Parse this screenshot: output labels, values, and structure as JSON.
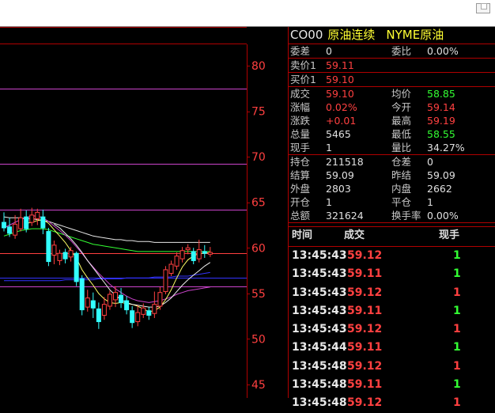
{
  "header": {
    "code": "CO00",
    "name": "原油连续",
    "category": "NYME原油"
  },
  "quote_groups": [
    [
      {
        "l1": "委差",
        "v1": "0",
        "c1": "white",
        "l2": "委比",
        "v2": "0.00%",
        "c2": "white"
      }
    ],
    [
      {
        "l1": "卖价1",
        "v1": "59.11",
        "c1": "red",
        "l2": "",
        "v2": "",
        "c2": "white"
      }
    ],
    [
      {
        "l1": "买价1",
        "v1": "59.10",
        "c1": "red",
        "l2": "",
        "v2": "",
        "c2": "white"
      }
    ],
    [
      {
        "l1": "成交",
        "v1": "59.10",
        "c1": "red",
        "l2": "均价",
        "v2": "58.85",
        "c2": "green"
      },
      {
        "l1": "涨幅",
        "v1": "0.02%",
        "c1": "red",
        "l2": "今开",
        "v2": "59.14",
        "c2": "red"
      },
      {
        "l1": "涨跌",
        "v1": "+0.01",
        "c1": "red",
        "l2": "最高",
        "v2": "59.19",
        "c2": "red"
      },
      {
        "l1": "总量",
        "v1": "5465",
        "c1": "white",
        "l2": "最低",
        "v2": "58.55",
        "c2": "green"
      },
      {
        "l1": "现手",
        "v1": "1",
        "c1": "white",
        "l2": "量比",
        "v2": "34.27%",
        "c2": "white"
      }
    ],
    [
      {
        "l1": "持仓",
        "v1": "211518",
        "c1": "white",
        "l2": "仓差",
        "v2": "0",
        "c2": "white"
      },
      {
        "l1": "结算",
        "v1": "59.09",
        "c1": "white",
        "l2": "昨结",
        "v2": "59.09",
        "c2": "white"
      },
      {
        "l1": "外盘",
        "v1": "2803",
        "c1": "white",
        "l2": "内盘",
        "v2": "2662",
        "c2": "white"
      },
      {
        "l1": "开仓",
        "v1": "1",
        "c1": "white",
        "l2": "平仓",
        "v2": "1",
        "c2": "white"
      },
      {
        "l1": "总额",
        "v1": "321624",
        "c1": "white",
        "l2": "换手率",
        "v2": "0.00%",
        "c2": "white"
      }
    ]
  ],
  "ticks": {
    "headers": {
      "time": "时间",
      "price": "成交",
      "volume": "现手"
    },
    "rows": [
      {
        "time": "13:45:43",
        "price": "59.12",
        "pc": "red",
        "vol": "1",
        "vc": "green"
      },
      {
        "time": "13:45:43",
        "price": "59.11",
        "pc": "red",
        "vol": "1",
        "vc": "green"
      },
      {
        "time": "13:45:43",
        "price": "59.12",
        "pc": "red",
        "vol": "1",
        "vc": "red"
      },
      {
        "time": "13:45:43",
        "price": "59.11",
        "pc": "red",
        "vol": "1",
        "vc": "green"
      },
      {
        "time": "13:45:43",
        "price": "59.12",
        "pc": "red",
        "vol": "1",
        "vc": "red"
      },
      {
        "time": "13:45:44",
        "price": "59.11",
        "pc": "red",
        "vol": "1",
        "vc": "green"
      },
      {
        "time": "13:45:48",
        "price": "59.12",
        "pc": "red",
        "vol": "1",
        "vc": "red"
      },
      {
        "time": "13:45:48",
        "price": "59.11",
        "pc": "red",
        "vol": "1",
        "vc": "green"
      },
      {
        "time": "13:45:48",
        "price": "59.12",
        "pc": "red",
        "vol": "1",
        "vc": "red"
      }
    ]
  },
  "chart_data": {
    "type": "candlestick",
    "y_ticks": [
      "80",
      "75",
      "70",
      "65",
      "60",
      "55",
      "50",
      "45"
    ],
    "ylim": [
      44,
      82
    ],
    "h_lines": [
      {
        "value": 77.5,
        "color": "#cc44cc"
      },
      {
        "value": 69.2,
        "color": "#cc44cc"
      },
      {
        "value": 64.2,
        "color": "#cc44cc"
      },
      {
        "value": 59.4,
        "color": "#ff4040"
      },
      {
        "value": 56.7,
        "color": "#3333ff"
      },
      {
        "value": 55.8,
        "color": "#cc44cc"
      }
    ],
    "candles": [
      {
        "o": 62.8,
        "c": 62.2,
        "h": 63.9,
        "l": 61.8
      },
      {
        "o": 62.3,
        "c": 61.6,
        "h": 63.3,
        "l": 61.2
      },
      {
        "o": 61.4,
        "c": 62.6,
        "h": 63.6,
        "l": 61.0
      },
      {
        "o": 62.1,
        "c": 63.3,
        "h": 64.3,
        "l": 61.8
      },
      {
        "o": 63.4,
        "c": 62.1,
        "h": 64.1,
        "l": 61.7
      },
      {
        "o": 62.8,
        "c": 63.6,
        "h": 64.4,
        "l": 62.4
      },
      {
        "o": 63.2,
        "c": 63.9,
        "h": 64.3,
        "l": 62.5
      },
      {
        "o": 63.4,
        "c": 62.2,
        "h": 64.2,
        "l": 61.5
      },
      {
        "o": 61.8,
        "c": 58.5,
        "h": 62.2,
        "l": 58.0
      },
      {
        "o": 59.2,
        "c": 60.3,
        "h": 60.8,
        "l": 58.2
      },
      {
        "o": 58.6,
        "c": 59.4,
        "h": 59.8,
        "l": 58.1
      },
      {
        "o": 59.5,
        "c": 58.8,
        "h": 59.9,
        "l": 58.3
      },
      {
        "o": 59.0,
        "c": 59.7,
        "h": 60.1,
        "l": 58.5
      },
      {
        "o": 59.4,
        "c": 56.3,
        "h": 59.6,
        "l": 55.8
      },
      {
        "o": 56.6,
        "c": 53.2,
        "h": 57.0,
        "l": 52.6
      },
      {
        "o": 53.5,
        "c": 54.5,
        "h": 55.4,
        "l": 53.0
      },
      {
        "o": 54.2,
        "c": 53.4,
        "h": 55.1,
        "l": 52.3
      },
      {
        "o": 53.3,
        "c": 51.9,
        "h": 54.0,
        "l": 51.1
      },
      {
        "o": 52.6,
        "c": 53.8,
        "h": 54.6,
        "l": 52.1
      },
      {
        "o": 53.6,
        "c": 54.9,
        "h": 55.3,
        "l": 53.2
      },
      {
        "o": 54.3,
        "c": 55.1,
        "h": 55.8,
        "l": 53.5
      },
      {
        "o": 54.8,
        "c": 54.0,
        "h": 55.6,
        "l": 53.4
      },
      {
        "o": 54.2,
        "c": 53.2,
        "h": 54.7,
        "l": 52.7
      },
      {
        "o": 53.1,
        "c": 51.8,
        "h": 53.6,
        "l": 51.2
      },
      {
        "o": 51.9,
        "c": 52.9,
        "h": 53.7,
        "l": 51.4
      },
      {
        "o": 52.7,
        "c": 53.4,
        "h": 53.9,
        "l": 52.3
      },
      {
        "o": 53.1,
        "c": 52.6,
        "h": 53.5,
        "l": 52.1
      },
      {
        "o": 52.8,
        "c": 53.8,
        "h": 55.2,
        "l": 52.3
      },
      {
        "o": 53.6,
        "c": 55.1,
        "h": 55.7,
        "l": 53.2
      },
      {
        "o": 55.2,
        "c": 57.6,
        "h": 58.0,
        "l": 54.9
      },
      {
        "o": 57.2,
        "c": 58.2,
        "h": 58.6,
        "l": 56.9
      },
      {
        "o": 58.0,
        "c": 59.1,
        "h": 59.5,
        "l": 57.6
      },
      {
        "o": 58.8,
        "c": 59.7,
        "h": 60.1,
        "l": 58.4
      },
      {
        "o": 59.8,
        "c": 60.0,
        "h": 60.4,
        "l": 59.3
      },
      {
        "o": 59.6,
        "c": 58.6,
        "h": 60.0,
        "l": 58.2
      },
      {
        "o": 58.8,
        "c": 59.8,
        "h": 60.9,
        "l": 58.4
      },
      {
        "o": 59.6,
        "c": 59.4,
        "h": 60.3,
        "l": 58.9
      },
      {
        "o": 59.3,
        "c": 59.5,
        "h": 60.1,
        "l": 59.0
      }
    ],
    "ma_lines": [
      {
        "color": "#e8e8e8",
        "values": [
          63.4,
          63.3,
          63.3,
          63.3,
          63.2,
          63.2,
          63.1,
          63.0,
          62.9,
          62.7,
          62.5,
          62.3,
          62.1,
          61.9,
          61.7,
          61.5,
          61.3,
          61.2,
          61.1,
          61.0,
          60.9,
          60.9,
          60.8,
          60.8,
          60.7,
          60.7,
          60.7,
          60.6,
          60.6,
          60.6,
          60.6,
          60.6,
          60.6,
          60.6,
          60.6,
          60.6,
          60.6,
          60.6
        ]
      },
      {
        "color": "#33ff33",
        "values": [
          61.3,
          61.5,
          61.7,
          61.9,
          62.0,
          62.1,
          62.1,
          62.1,
          62.0,
          61.8,
          61.6,
          61.4,
          61.2,
          61.0,
          60.8,
          60.6,
          60.4,
          60.3,
          60.2,
          60.1,
          60.0,
          59.9,
          59.8,
          59.7,
          59.6,
          59.6,
          59.6,
          59.6,
          59.6,
          59.6,
          59.6,
          59.6,
          59.6,
          59.6,
          59.6,
          59.6,
          59.6,
          59.6
        ]
      },
      {
        "color": "#cc44cc",
        "values": [
          62.2,
          62.5,
          62.8,
          63.1,
          63.3,
          63.5,
          63.5,
          63.3,
          62.9,
          62.4,
          61.9,
          61.4,
          60.8,
          60.1,
          59.4,
          58.6,
          57.9,
          57.2,
          56.6,
          56.0,
          55.5,
          55.1,
          54.7,
          54.4,
          54.2,
          54.1,
          54.0,
          54.1,
          54.2,
          54.4,
          54.6,
          54.9,
          55.1,
          55.3,
          55.4,
          55.5,
          55.6,
          55.7
        ]
      },
      {
        "color": "#3333ff",
        "values": [
          56.4,
          56.4,
          56.4,
          56.4,
          56.4,
          56.4,
          56.4,
          56.4,
          56.4,
          56.4,
          56.4,
          56.5,
          56.5,
          56.5,
          56.5,
          56.5,
          56.5,
          56.6,
          56.6,
          56.6,
          56.6,
          56.6,
          56.7,
          56.7,
          56.7,
          56.7,
          56.7,
          56.8,
          56.8,
          56.8,
          56.8,
          56.9,
          56.9,
          56.9,
          57.0,
          57.1,
          57.2,
          57.3
        ]
      },
      {
        "color": "#ffff66",
        "values": [
          null,
          null,
          null,
          null,
          62.7,
          62.8,
          63.0,
          63.1,
          62.7,
          62.0,
          61.3,
          60.6,
          59.7,
          58.9,
          57.6,
          56.7,
          55.9,
          55.0,
          54.4,
          54.0,
          53.9,
          54.0,
          53.9,
          53.8,
          53.6,
          53.3,
          53.0,
          53.1,
          53.5,
          54.3,
          55.4,
          56.7,
          57.9,
          58.7,
          59.1,
          59.4,
          59.4,
          59.5
        ]
      },
      {
        "color": "#f0f0f0",
        "values": [
          null,
          null,
          null,
          null,
          null,
          null,
          null,
          null,
          null,
          62.6,
          62.2,
          61.6,
          61.0,
          60.3,
          59.5,
          58.6,
          57.8,
          57.0,
          56.2,
          55.4,
          54.8,
          54.3,
          54.0,
          53.8,
          53.7,
          53.6,
          53.5,
          53.5,
          53.6,
          54.0,
          54.5,
          55.2,
          55.9,
          56.5,
          57.0,
          57.5,
          58.0,
          58.4
        ]
      }
    ]
  }
}
